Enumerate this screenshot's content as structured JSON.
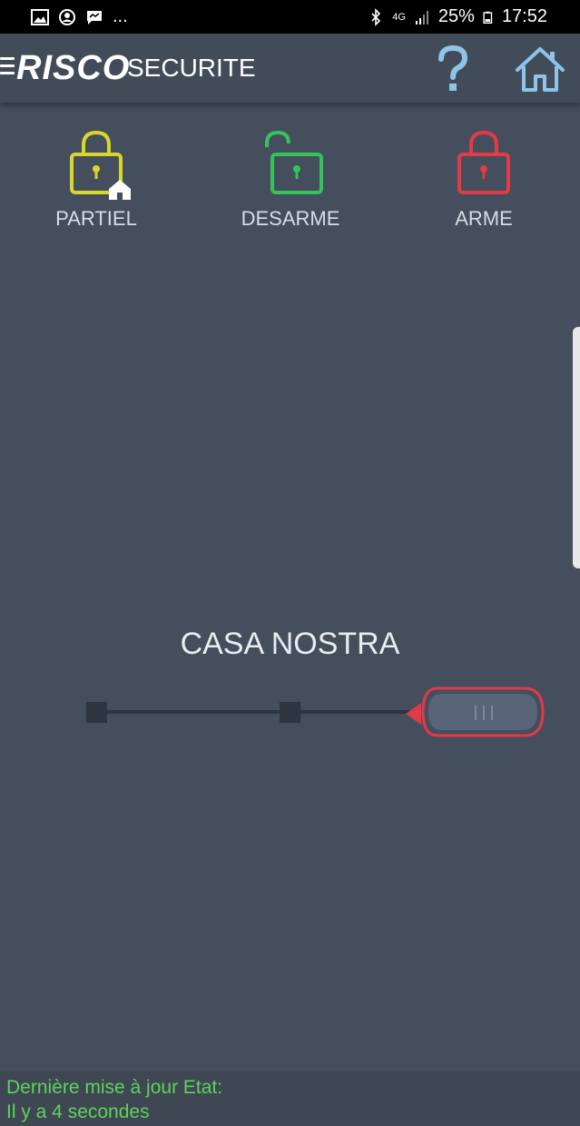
{
  "status_bar": {
    "dots": "...",
    "network": "4G",
    "battery": "25%",
    "time": "17:52"
  },
  "header": {
    "logo_text": "RISCO",
    "title": "SECURITE"
  },
  "modes": [
    {
      "label": "PARTIEL",
      "color": "#d8d62a"
    },
    {
      "label": "DESARME",
      "color": "#33c45a"
    },
    {
      "label": "ARME",
      "color": "#e23a47"
    }
  ],
  "site": {
    "name": "CASA NOSTRA"
  },
  "slider": {
    "state": "ARME",
    "accent_color": "#e23a47",
    "positions": 3,
    "selected_index": 2
  },
  "footer": {
    "line1": "Dernière mise à jour Etat:",
    "line2": "Il y a 4 secondes"
  }
}
